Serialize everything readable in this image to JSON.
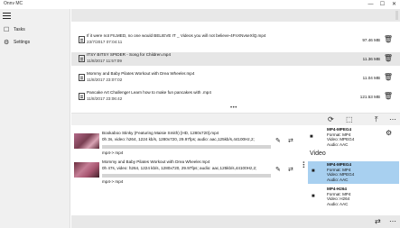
{
  "app": {
    "title": "Onnv MC"
  },
  "window_controls": {
    "minimize": "—",
    "maximize": "☐",
    "close": "✕"
  },
  "sidebar": {
    "menu_icon": "hamburger-icon",
    "items": [
      {
        "label": "Tasks",
        "icon": "tasks-icon",
        "glyph": "☐"
      },
      {
        "label": "Settings",
        "icon": "gear-icon",
        "glyph": "⚙"
      }
    ]
  },
  "files": [
    {
      "name": "If it were not FILMED, no one would BELIEVE IT _ Videos you will not believe-4FnXNvseXlQ.mp4",
      "date": "23/7/2017 07:04:11",
      "size": "97.46 MB",
      "selected": false
    },
    {
      "name": "ITSY BITSY SPIDER - Song for Children.mp4",
      "date": "11/8/2017 11:57:09",
      "size": "11.36 MB",
      "selected": true
    },
    {
      "name": "Mommy and Baby Pilates Workout with Drea Wheeler.mp4",
      "date": "11/8/2017 23:07:02",
      "size": "11.04 MB",
      "selected": false
    },
    {
      "name": "Pancake Art Challenge! Learn how to make fun pancakes with .mp4",
      "date": "11/8/2017 23:06:42",
      "size": "121.53 MB",
      "selected": false
    }
  ],
  "file_delete_glyph": "🗑",
  "grip": "•••",
  "toolbar": {
    "refresh": "⟳",
    "stamp": "⬚",
    "upload": "⤒",
    "more": "⋯"
  },
  "queue": [
    {
      "title": "Bookaboo  Stinky (Featuring Maisie Smith) [HD, 1280x720].mp4",
      "meta": "0h 3s, video: h264, 1224 kb/s, 1280x720, 29.97fps; audio: aac,125kb/s,44100Hz,2;",
      "convert": "mp4-> mp4",
      "progress": 0
    },
    {
      "title": "Mommy and Baby Pilates Workout with Drea Wheeler.mp4",
      "meta": "0h 47s, video: h264, 1224 kb/s, 1280x720, 29.97fps; audio: aac,125kb/s,44100Hz,2;",
      "convert": "mp4-> mp4",
      "progress": 0
    }
  ],
  "queue_icons": {
    "edit": "✎",
    "swap": "⇄"
  },
  "presets": {
    "top": {
      "title": "MP4-MPEG4",
      "format": "Format: MP4",
      "video": "Video: MPEG4",
      "audio": "Audio: AAC"
    },
    "gear": "⚙",
    "section": "Video",
    "items": [
      {
        "title": "MP4-MPEG4",
        "format": "Format: MP4",
        "video": "Video: MPEG4",
        "audio": "Audio: AAC",
        "selected": true
      },
      {
        "title": "MP4-H264",
        "format": "Format: MP4",
        "video": "Video: H264",
        "audio": "Audio: AAC",
        "selected": false
      }
    ],
    "film_glyph": "■"
  },
  "bottom": {
    "swap": "⇄",
    "more": "⋯"
  },
  "colors": {
    "selection": "#a8d0f0",
    "row_selected": "#e6e6e6",
    "bar": "#e8e8e8"
  }
}
